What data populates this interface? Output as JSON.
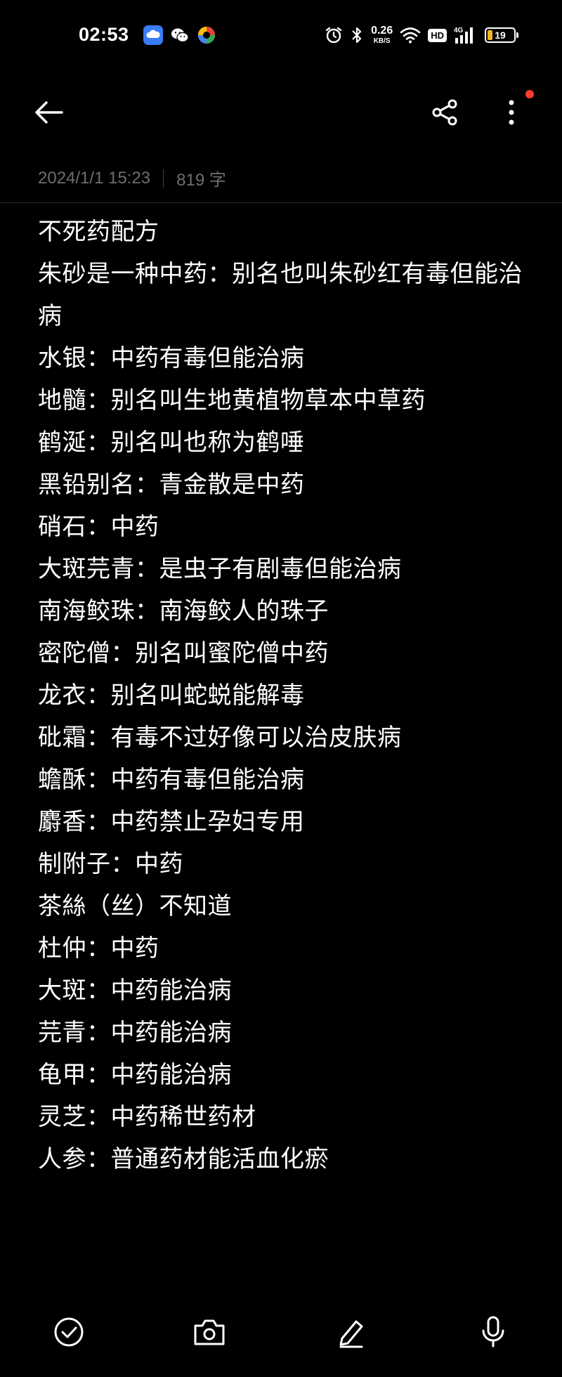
{
  "status_bar": {
    "time": "02:53",
    "net_speed_value": "0.26",
    "net_speed_unit": "KB/S",
    "hd_label": "HD",
    "signal_label": "4G",
    "battery_level": "19",
    "apps": [
      "cloud-app-icon",
      "wechat-icon",
      "colorful-app-icon"
    ],
    "battery_color": "#f5b623"
  },
  "toolbar": {
    "back_icon": "back-arrow-icon",
    "share_icon": "share-icon",
    "more_icon": "more-vertical-icon",
    "notification_dot_color": "#ff3b30"
  },
  "meta": {
    "datetime": "2024/1/1 15:23",
    "word_count": "819 字"
  },
  "note": {
    "lines": [
      "不死药配方",
      "朱砂是一种中药：别名也叫朱砂红有毒但能治病",
      "水银：中药有毒但能治病",
      "地髓：别名叫生地黄植物草本中草药",
      "鹤涎：别名叫也称为鹤唾",
      "黑铅别名：青金散是中药",
      "硝石：中药",
      "大斑芫青：是虫子有剧毒但能治病",
      "南海鲛珠：南海鲛人的珠子",
      "密陀僧：别名叫蜜陀僧中药",
      "龙衣：别名叫蛇蜕能解毒",
      "砒霜：有毒不过好像可以治皮肤病",
      "蟾酥：中药有毒但能治病",
      "麝香：中药禁止孕妇专用",
      "制附子：中药",
      "茶絲（丝）不知道",
      "杜仲：中药",
      "大斑：中药能治病",
      "芫青：中药能治病",
      "龟甲：中药能治病",
      "灵芝：中药稀世药材",
      "人参：普通药材能活血化瘀"
    ]
  },
  "bottom_bar": {
    "icons": [
      "checklist-icon",
      "camera-icon",
      "pen-icon",
      "microphone-icon"
    ]
  }
}
